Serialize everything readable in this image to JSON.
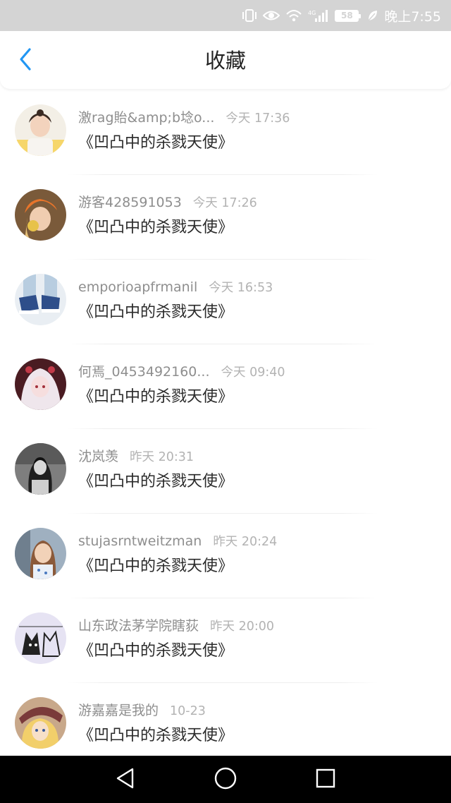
{
  "status_bar": {
    "battery": "58",
    "time": "晚上7:55",
    "network": "4G",
    "icons": [
      "vibrate-icon",
      "eye-icon",
      "wifi-icon",
      "signal-icon",
      "battery-icon",
      "leaf-icon"
    ]
  },
  "header": {
    "title": "收藏",
    "back_icon": "chevron-left-icon",
    "accent_color": "#2196f3"
  },
  "favorites": [
    {
      "username": "激rag貽&amp;b埝o...",
      "time": "今天 17:36",
      "content": "《凹凸中的杀戮天使》"
    },
    {
      "username": "游客428591053",
      "time": "今天 17:26",
      "content": "《凹凸中的杀戮天使》"
    },
    {
      "username": "emporioapfrmanil",
      "time": "今天 16:53",
      "content": "《凹凸中的杀戮天使》"
    },
    {
      "username": "何焉_0453492160...",
      "time": "今天 09:40",
      "content": "《凹凸中的杀戮天使》"
    },
    {
      "username": "沈岚羡",
      "time": "昨天 20:31",
      "content": "《凹凸中的杀戮天使》"
    },
    {
      "username": "stujasrntweitzman",
      "time": "昨天 20:24",
      "content": "《凹凸中的杀戮天使》"
    },
    {
      "username": "山东政法茅学院瞎荻",
      "time": "昨天 20:00",
      "content": "《凹凸中的杀戮天使》"
    },
    {
      "username": "游嘉嘉是我的",
      "time": "10-23",
      "content": "《凹凸中的杀戮天使》"
    }
  ],
  "nav_bar": {
    "icons": [
      "back-triangle-icon",
      "home-circle-icon",
      "recents-square-icon"
    ]
  }
}
